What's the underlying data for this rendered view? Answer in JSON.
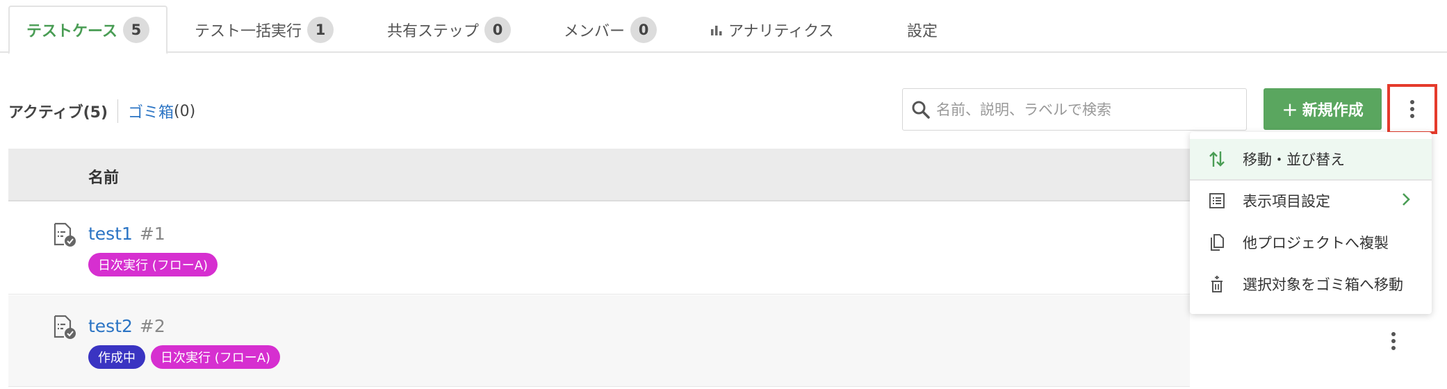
{
  "tabs": [
    {
      "label": "テストケース",
      "count": "5"
    },
    {
      "label": "テスト一括実行",
      "count": "1"
    },
    {
      "label": "共有ステップ",
      "count": "0"
    },
    {
      "label": "メンバー",
      "count": "0"
    },
    {
      "label": "アナリティクス",
      "icon": "bar-chart-icon"
    },
    {
      "label": "設定"
    }
  ],
  "filters": {
    "active_label": "アクティブ(5)",
    "trash_label": "ゴミ箱",
    "trash_count": "(0)"
  },
  "search": {
    "placeholder": "名前、説明、ラベルで検索",
    "value": ""
  },
  "toolbar": {
    "new_plus": "+",
    "new_label": "新規作成"
  },
  "table": {
    "column_name": "名前"
  },
  "rows": [
    {
      "name": "test1",
      "number": "#1",
      "tags": [
        {
          "label": "日次実行 (フローA)",
          "color": "#d62fd0"
        }
      ]
    },
    {
      "name": "test2",
      "number": "#2",
      "tags": [
        {
          "label": "作成中",
          "color": "#3a34c2"
        },
        {
          "label": "日次実行 (フローA)",
          "color": "#d62fd0"
        }
      ]
    }
  ],
  "menu": {
    "items": [
      {
        "label": "移動・並び替え",
        "icon": "sort-arrows-icon"
      },
      {
        "label": "表示項目設定",
        "icon": "list-settings-icon"
      },
      {
        "label": "他プロジェクトへ複製",
        "icon": "copy-icon"
      },
      {
        "label": "選択対象をゴミ箱へ移動",
        "icon": "trash-icon"
      }
    ]
  },
  "colors": {
    "accent_green": "#5aa65f",
    "link_blue": "#2b74c4",
    "highlight_red": "#e53b2c"
  }
}
